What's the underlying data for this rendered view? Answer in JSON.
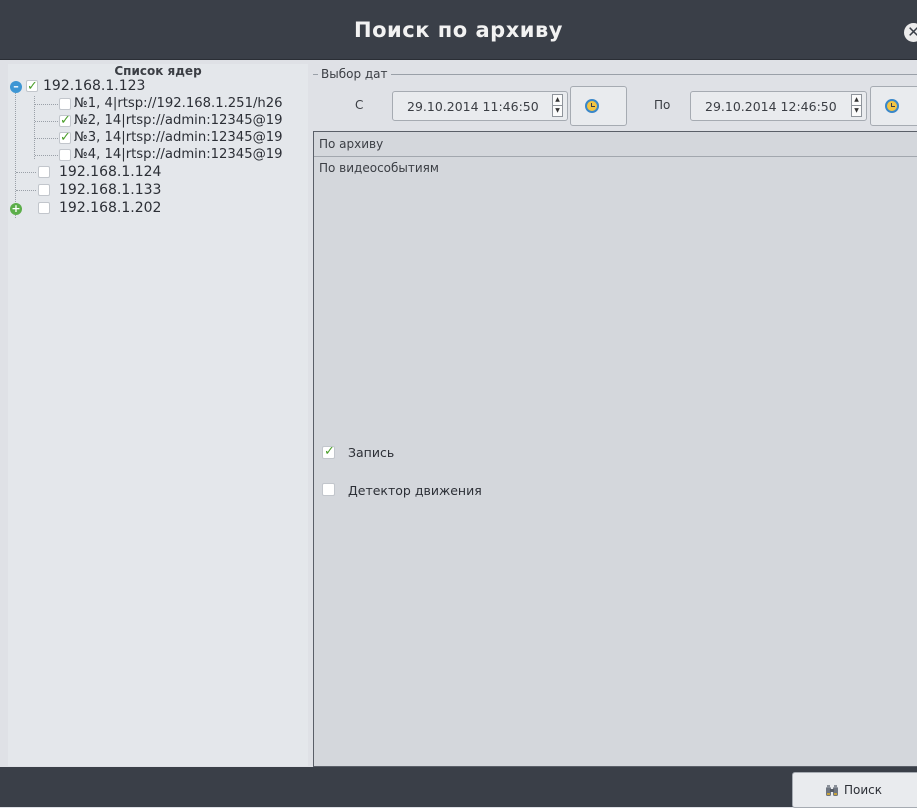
{
  "window": {
    "title": "Поиск по архиву"
  },
  "sidebar": {
    "header": "Список ядер",
    "cores": [
      {
        "label": "192.168.1.123",
        "expanded": true,
        "checked": true,
        "channels": [
          {
            "label": "№1, 4|rtsp://192.168.1.251/h26",
            "checked": false
          },
          {
            "label": "№2, 14|rtsp://admin:12345@19",
            "checked": true
          },
          {
            "label": "№3, 14|rtsp://admin:12345@19",
            "checked": true
          },
          {
            "label": "№4, 14|rtsp://admin:12345@19",
            "checked": false
          }
        ]
      },
      {
        "label": "192.168.1.124",
        "checked": false
      },
      {
        "label": "192.168.1.133",
        "checked": false
      },
      {
        "label": "192.168.1.202",
        "checked": false,
        "expandable": true
      }
    ]
  },
  "date_group": {
    "legend": "Выбор дат",
    "from_label": "С",
    "from_value": "29.10.2014 11:46:50",
    "to_label": "По",
    "to_value": "29.10.2014 12:46:50"
  },
  "panel": {
    "tab_label": "По архиву",
    "section_label": "По видеособытиям",
    "options": [
      {
        "label": "Запись",
        "checked": true
      },
      {
        "label": "Детектор движения",
        "checked": false
      }
    ]
  },
  "footer": {
    "search_label": "Поиск"
  },
  "icons": {
    "close": "close-icon",
    "clock": "clock-icon",
    "search": "binoculars-icon"
  },
  "colors": {
    "titlebar": "#3a3f48",
    "check": "#4a9e2a",
    "expander_minus": "#3e96d4",
    "expander_plus": "#5cae4a"
  }
}
